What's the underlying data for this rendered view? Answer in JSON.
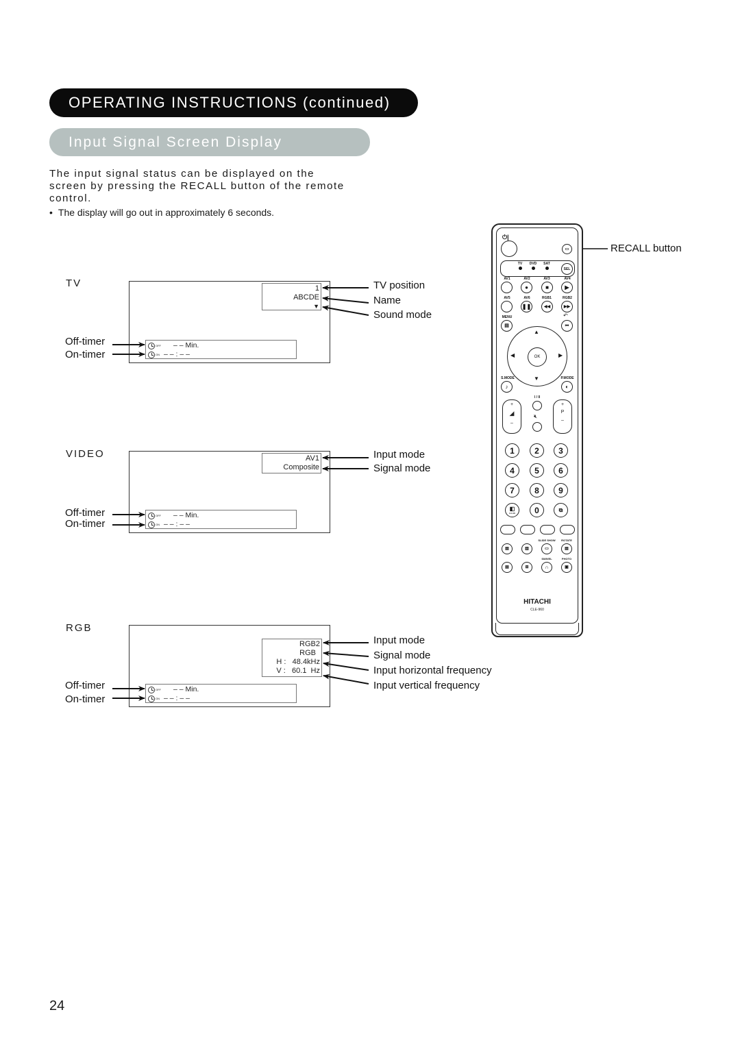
{
  "header": {
    "title": "OPERATING INSTRUCTIONS (continued)",
    "subtitle": "Input Signal Screen Display"
  },
  "intro": {
    "text": "The input signal status can be displayed on the screen by pressing the RECALL button of the remote control.",
    "note": "The display will go out in approximately 6 seconds."
  },
  "sections": {
    "tv": {
      "label": "TV",
      "info_lines": [
        "1",
        "ABCDE",
        "▼"
      ],
      "callouts": [
        "TV position",
        "Name",
        "Sound mode"
      ],
      "off_timer_label": "Off-timer",
      "on_timer_label": "On-timer",
      "off_timer_value": "– – Min.",
      "on_timer_value": "– – : – –"
    },
    "video": {
      "label": "VIDEO",
      "info_lines": [
        "AV1",
        "Composite"
      ],
      "callouts": [
        "Input mode",
        "Signal mode"
      ],
      "off_timer_label": "Off-timer",
      "on_timer_label": "On-timer",
      "off_timer_value": "– – Min.",
      "on_timer_value": "– – : – –"
    },
    "rgb": {
      "label": "RGB",
      "info_lines": [
        "RGB2",
        "RGB",
        "H :   48.4kHz",
        "V :   60.1  Hz"
      ],
      "callouts": [
        "Input mode",
        "Signal mode",
        "Input horizontal frequency",
        "Input vertical frequency"
      ],
      "off_timer_label": "Off-timer",
      "on_timer_label": "On-timer",
      "off_timer_value": "– – Min.",
      "on_timer_value": "– – : – –"
    }
  },
  "timer_icon_tags": {
    "off": "OFF",
    "on": "ON"
  },
  "remote": {
    "recall_callout": "RECALL button",
    "power_label": "⏻|",
    "source_labels": [
      "TV",
      "DVD",
      "SAT"
    ],
    "sel_label": "SEL",
    "row1_labels": [
      "AV1",
      "AV2",
      "AV3",
      "AV4"
    ],
    "row2_labels": [
      "AV5",
      "AV6",
      "RGB1",
      "RGB2"
    ],
    "menu_label": "MENU",
    "ok_label": "OK",
    "smode_label": "S.MODE",
    "pmode_label": "P.MODE",
    "dual_label": "I / II",
    "vol_plus": "+",
    "vol_minus": "–",
    "ch_plus": "+",
    "ch_label": "P",
    "ch_minus": "–",
    "digits": [
      "1",
      "2",
      "3",
      "4",
      "5",
      "6",
      "7",
      "8",
      "9",
      "0"
    ],
    "sub_label_1610": "3-4-16",
    "slideshow_label": "SLIDE SHOW",
    "rotate_label": "ROTATE",
    "swivel_label": "SWIVEL",
    "photo_label": "PHOTO",
    "brand": "HITACHI",
    "model": "CLE-960"
  },
  "page_number": "24"
}
